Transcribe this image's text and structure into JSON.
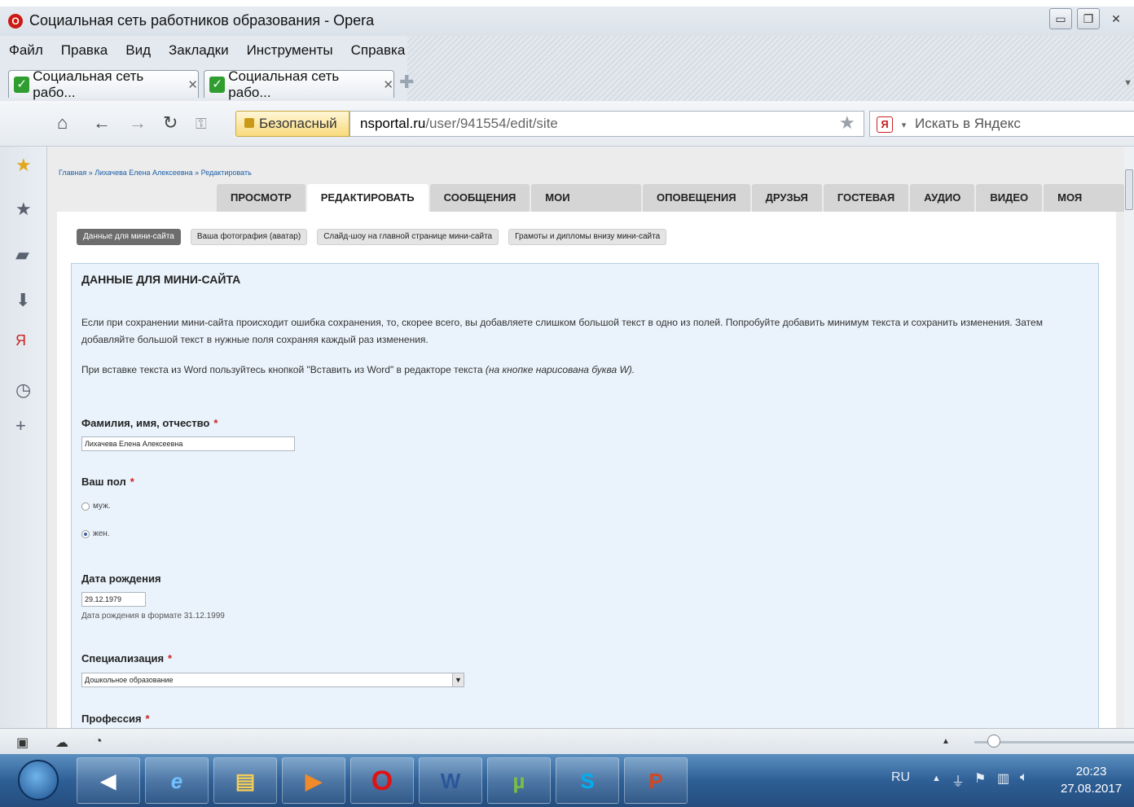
{
  "window": {
    "title": "Социальная сеть работников образования - Opera"
  },
  "menu": [
    "Файл",
    "Правка",
    "Вид",
    "Закладки",
    "Инструменты",
    "Справка"
  ],
  "tabs": [
    {
      "label": "Социальная сеть рабо..."
    },
    {
      "label": "Социальная сеть рабо..."
    }
  ],
  "address": {
    "security": "Безопасный",
    "host": "nsportal.ru",
    "path": "/user/941554/edit/site",
    "search_placeholder": "Искать в Яндекс"
  },
  "page": {
    "breadcrumb": "Главная » Лихачева Елена Алексеевна » Редактировать",
    "nav_tabs": [
      "ПРОСМОТР",
      "РЕДАКТИРОВАТЬ",
      "СООБЩЕНИЯ",
      "МОИ РЕЗУЛЬТАТЫ",
      "ОПОВЕЩЕНИЯ",
      "ДРУЗЬЯ",
      "ГОСТЕВАЯ",
      "АУДИО",
      "ВИДЕО",
      "МОЯ ЛЕНТА"
    ],
    "active_tab": "РЕДАКТИРОВАТЬ",
    "subtabs": [
      "Данные для мини-сайта",
      "Ваша фотография (аватар)",
      "Слайд-шоу на главной странице мини-сайта",
      "Грамоты и дипломы внизу мини-сайта"
    ],
    "active_subtab": "Данные для мини-сайта",
    "form_title": "ДАННЫЕ ДЛЯ МИНИ-САЙТА",
    "info1": "Если при сохранении мини-сайта происходит ошибка сохранения, то, скорее всего, вы добавляете слишком большой текст в одно из полей. Попробуйте добавить минимум текста и сохранить изменения. Затем добавляйте большой текст в нужные поля сохраняя каждый раз изменения.",
    "info2_text": "При вставке текста из Word пользуйтесь кнопкой \"Вставить из Word\" в редакторе текста ",
    "info2_note": "(на кнопке нарисована буква W).",
    "fields": {
      "name_label": "Фамилия, имя, отчество",
      "name_value": "Лихачева Елена Алексеевна",
      "gender_label": "Ваш пол",
      "gender_options": [
        "муж.",
        "жен."
      ],
      "gender_selected": "жен.",
      "birth_label": "Дата рождения",
      "birth_value": "29.12.1979",
      "birth_hint": "Дата рождения в формате 31.12.1999",
      "spec_label": "Специализация",
      "spec_value": "Дошкольное образование",
      "prof_label": "Профессия"
    },
    "required_mark": "*"
  },
  "taskbar": {
    "lang": "RU",
    "time": "20:23",
    "date": "27.08.2017"
  },
  "colors": {
    "accent": "#1d5fa7",
    "form_bg": "#eaf3fb",
    "required": "#d02020",
    "opera_red": "#cc1a14"
  }
}
